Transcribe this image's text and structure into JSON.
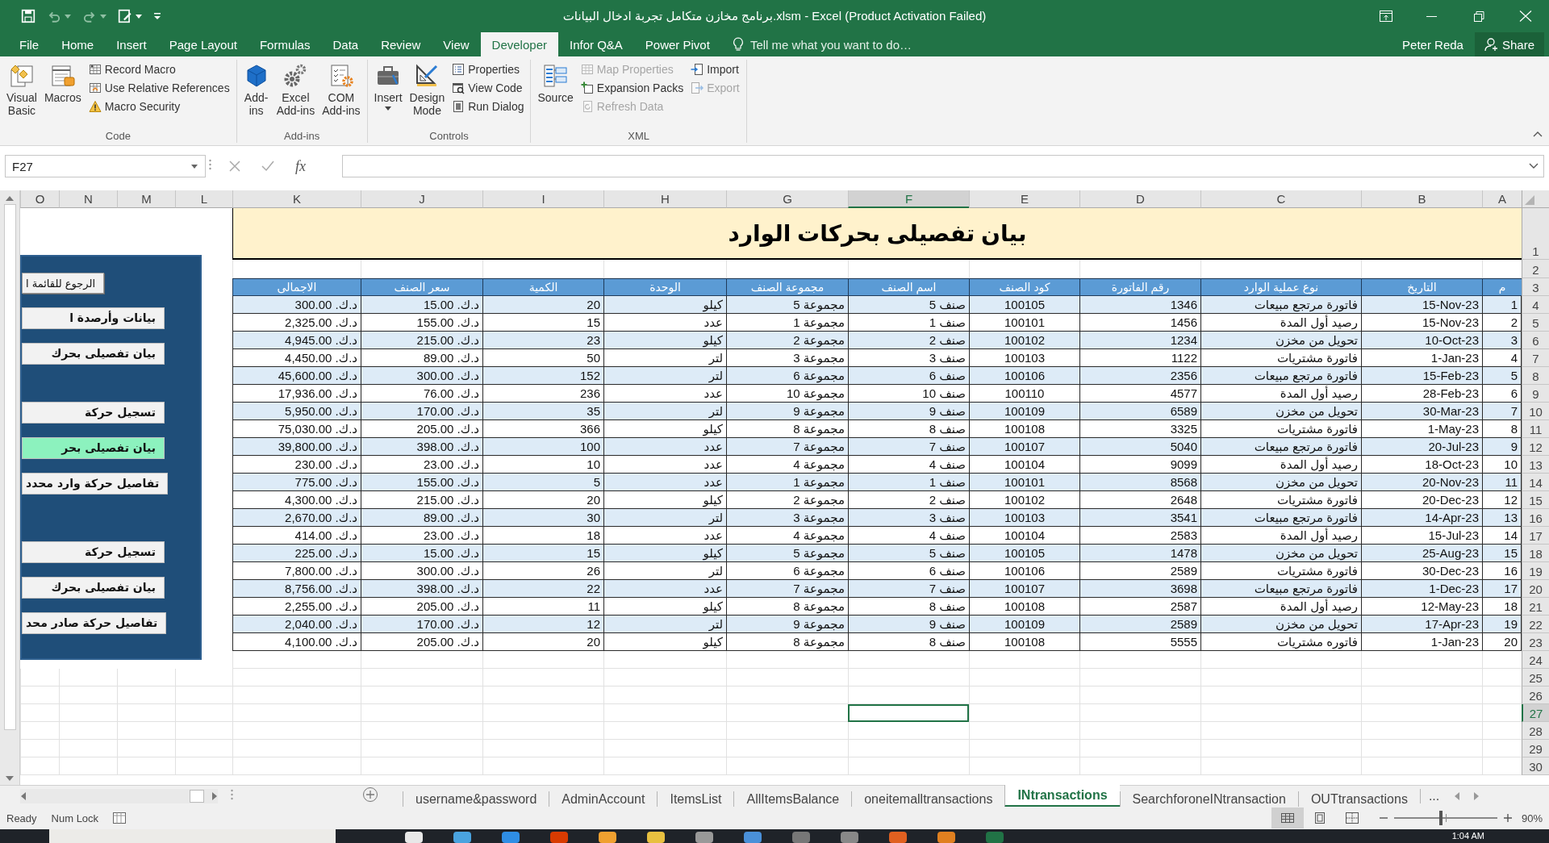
{
  "window": {
    "title": "برنامج مخازن متكامل تجربة ادخال البيانات.xlsm - Excel (Product Activation Failed)"
  },
  "ribbon_tabs": [
    {
      "label": "Power Pivot",
      "selected": false
    },
    {
      "label": "Infor Q&A",
      "selected": false
    },
    {
      "label": "Developer",
      "selected": true
    },
    {
      "label": "View",
      "selected": false
    },
    {
      "label": "Review",
      "selected": false
    },
    {
      "label": "Data",
      "selected": false
    },
    {
      "label": "Formulas",
      "selected": false
    },
    {
      "label": "Page Layout",
      "selected": false
    },
    {
      "label": "Insert",
      "selected": false
    },
    {
      "label": "Home",
      "selected": false
    },
    {
      "label": "File",
      "selected": false
    }
  ],
  "tell_me": {
    "placeholder": "Tell me what you want to do…"
  },
  "user": "Peter Reda",
  "share_button": "Share",
  "ribbon": {
    "groups": [
      {
        "label": "XML",
        "items": [
          {
            "kind": "stack",
            "items": [
              {
                "kind": "small",
                "label": "Import",
                "dropdown": false,
                "disabled": false
              },
              {
                "kind": "small",
                "label": "Export",
                "dropdown": false,
                "disabled": true
              }
            ]
          },
          {
            "kind": "stack",
            "items": [
              {
                "kind": "small",
                "label": "Map Properties",
                "dropdown": false,
                "disabled": true
              },
              {
                "kind": "small",
                "label": "Expansion Packs",
                "dropdown": false,
                "disabled": false
              },
              {
                "kind": "small",
                "label": "Refresh Data",
                "dropdown": false,
                "disabled": true
              }
            ]
          },
          {
            "kind": "large",
            "label": "Source",
            "dropdown": false,
            "disabled": false
          }
        ]
      },
      {
        "label": "Controls",
        "items": [
          {
            "kind": "stack",
            "items": [
              {
                "kind": "small",
                "label": "Properties",
                "dropdown": false,
                "disabled": false
              },
              {
                "kind": "small",
                "label": "View Code",
                "dropdown": false,
                "disabled": false
              },
              {
                "kind": "small",
                "label": "Run Dialog",
                "dropdown": false,
                "disabled": false
              }
            ]
          },
          {
            "kind": "large",
            "label": "Design\nMode",
            "dropdown": false,
            "disabled": false
          },
          {
            "kind": "large",
            "label": "Insert",
            "dropdown": true,
            "disabled": false
          }
        ]
      },
      {
        "label": "Add-ins",
        "items": [
          {
            "kind": "large",
            "label": "COM\nAdd-ins",
            "dropdown": false,
            "disabled": false
          },
          {
            "kind": "large",
            "label": "Excel\nAdd-ins",
            "dropdown": false,
            "disabled": false
          },
          {
            "kind": "large",
            "label": "Add-\nins",
            "dropdown": false,
            "disabled": false
          }
        ]
      },
      {
        "label": "Code",
        "items": [
          {
            "kind": "stack",
            "items": [
              {
                "kind": "small",
                "label": "Record Macro",
                "dropdown": false,
                "disabled": false
              },
              {
                "kind": "small",
                "label": "Use Relative References",
                "dropdown": false,
                "disabled": false
              },
              {
                "kind": "small",
                "label": "Macro Security",
                "dropdown": false,
                "disabled": false
              }
            ]
          },
          {
            "kind": "large",
            "label": "Macros",
            "dropdown": false,
            "disabled": false
          },
          {
            "kind": "large",
            "label": "Visual\nBasic",
            "dropdown": false,
            "disabled": false
          }
        ]
      }
    ]
  },
  "formula_bar": {
    "name_box": "F27",
    "insert_function": "fx"
  },
  "sheet": {
    "column_letters": [
      {
        "label": "A",
        "selected": false
      },
      {
        "label": "B",
        "selected": false
      },
      {
        "label": "C",
        "selected": false
      },
      {
        "label": "D",
        "selected": false
      },
      {
        "label": "E",
        "selected": false
      },
      {
        "label": "F",
        "selected": true
      },
      {
        "label": "G",
        "selected": false
      },
      {
        "label": "H",
        "selected": false
      },
      {
        "label": "I",
        "selected": false
      },
      {
        "label": "J",
        "selected": false
      },
      {
        "label": "K",
        "selected": false
      },
      {
        "label": "L",
        "selected": false
      },
      {
        "label": "M",
        "selected": false
      },
      {
        "label": "N",
        "selected": false
      },
      {
        "label": "O",
        "selected": false
      }
    ],
    "row_numbers": [
      {
        "label": "1",
        "selected": false
      },
      {
        "label": "2",
        "selected": false
      },
      {
        "label": "3",
        "selected": false
      },
      {
        "label": "4",
        "selected": false
      },
      {
        "label": "5",
        "selected": false
      },
      {
        "label": "6",
        "selected": false
      },
      {
        "label": "7",
        "selected": false
      },
      {
        "label": "8",
        "selected": false
      },
      {
        "label": "9",
        "selected": false
      },
      {
        "label": "10",
        "selected": false
      },
      {
        "label": "11",
        "selected": false
      },
      {
        "label": "12",
        "selected": false
      },
      {
        "label": "13",
        "selected": false
      },
      {
        "label": "14",
        "selected": false
      },
      {
        "label": "15",
        "selected": false
      },
      {
        "label": "16",
        "selected": false
      },
      {
        "label": "17",
        "selected": false
      },
      {
        "label": "18",
        "selected": false
      },
      {
        "label": "19",
        "selected": false
      },
      {
        "label": "20",
        "selected": false
      },
      {
        "label": "21",
        "selected": false
      },
      {
        "label": "22",
        "selected": false
      },
      {
        "label": "23",
        "selected": false
      },
      {
        "label": "24",
        "selected": false
      },
      {
        "label": "25",
        "selected": false
      },
      {
        "label": "26",
        "selected": false
      },
      {
        "label": "27",
        "selected": true
      },
      {
        "label": "28",
        "selected": false
      },
      {
        "label": "29",
        "selected": false
      },
      {
        "label": "30",
        "selected": false
      }
    ],
    "title": "بيان تفصيلى بحركات الوارد",
    "table": {
      "columns": [
        "م",
        "التاريخ",
        "نوع عملية الوارد",
        "رقم الفاتورة",
        "كود الصنف",
        "اسم الصنف",
        "مجموعة الصنف",
        "الوحدة",
        "الكمية",
        "سعر الصنف",
        "الاجمالى"
      ],
      "rows": [
        [
          "1",
          "15-Nov-23",
          "فاتورة مرتجع مبيعات",
          "1346",
          "100105",
          "صنف 5",
          "مجموعة 5",
          "كيلو",
          "20",
          "د.ك. 15.00",
          "د.ك. 300.00"
        ],
        [
          "2",
          "15-Nov-23",
          "رصيد أول المدة",
          "1456",
          "100101",
          "صنف 1",
          "مجموعة 1",
          "عدد",
          "15",
          "د.ك. 155.00",
          "د.ك. 2,325.00"
        ],
        [
          "3",
          "10-Oct-23",
          "تحويل من مخزن",
          "1234",
          "100102",
          "صنف 2",
          "مجموعة 2",
          "كيلو",
          "23",
          "د.ك. 215.00",
          "د.ك. 4,945.00"
        ],
        [
          "4",
          "1-Jan-23",
          "فاتورة مشتريات",
          "1122",
          "100103",
          "صنف 3",
          "مجموعة 3",
          "لتر",
          "50",
          "د.ك. 89.00",
          "د.ك. 4,450.00"
        ],
        [
          "5",
          "15-Feb-23",
          "فاتورة مرتجع مبيعات",
          "2356",
          "100106",
          "صنف 6",
          "مجموعة 6",
          "لتر",
          "152",
          "د.ك. 300.00",
          "د.ك. 45,600.00"
        ],
        [
          "6",
          "28-Feb-23",
          "رصيد أول المدة",
          "4577",
          "100110",
          "صنف 10",
          "مجموعة 10",
          "عدد",
          "236",
          "د.ك. 76.00",
          "د.ك. 17,936.00"
        ],
        [
          "7",
          "30-Mar-23",
          "تحويل من مخزن",
          "6589",
          "100109",
          "صنف 9",
          "مجموعة 9",
          "لتر",
          "35",
          "د.ك. 170.00",
          "د.ك. 5,950.00"
        ],
        [
          "8",
          "1-May-23",
          "فاتورة مشتريات",
          "3325",
          "100108",
          "صنف 8",
          "مجموعة 8",
          "كيلو",
          "366",
          "د.ك. 205.00",
          "د.ك. 75,030.00"
        ],
        [
          "9",
          "20-Jul-23",
          "فاتورة مرتجع مبيعات",
          "5040",
          "100107",
          "صنف 7",
          "مجموعة 7",
          "عدد",
          "100",
          "د.ك. 398.00",
          "د.ك. 39,800.00"
        ],
        [
          "10",
          "18-Oct-23",
          "رصيد أول المدة",
          "9099",
          "100104",
          "صنف 4",
          "مجموعة 4",
          "عدد",
          "10",
          "د.ك. 23.00",
          "د.ك. 230.00"
        ],
        [
          "11",
          "20-Nov-23",
          "تحويل من مخزن",
          "8568",
          "100101",
          "صنف 1",
          "مجموعة 1",
          "عدد",
          "5",
          "د.ك. 155.00",
          "د.ك. 775.00"
        ],
        [
          "12",
          "20-Dec-23",
          "فاتورة مشتريات",
          "2648",
          "100102",
          "صنف 2",
          "مجموعة 2",
          "كيلو",
          "20",
          "د.ك. 215.00",
          "د.ك. 4,300.00"
        ],
        [
          "13",
          "14-Apr-23",
          "فاتورة مرتجع مبيعات",
          "3541",
          "100103",
          "صنف 3",
          "مجموعة 3",
          "لتر",
          "30",
          "د.ك. 89.00",
          "د.ك. 2,670.00"
        ],
        [
          "14",
          "15-Jul-23",
          "رصيد أول المدة",
          "2583",
          "100104",
          "صنف 4",
          "مجموعة 4",
          "عدد",
          "18",
          "د.ك. 23.00",
          "د.ك. 414.00"
        ],
        [
          "15",
          "25-Aug-23",
          "تحويل من مخزن",
          "1478",
          "100105",
          "صنف 5",
          "مجموعة 5",
          "كيلو",
          "15",
          "د.ك. 15.00",
          "د.ك. 225.00"
        ],
        [
          "16",
          "30-Dec-23",
          "فاتورة مشتريات",
          "2589",
          "100106",
          "صنف 6",
          "مجموعة 6",
          "لتر",
          "26",
          "د.ك. 300.00",
          "د.ك. 7,800.00"
        ],
        [
          "17",
          "1-Dec-23",
          "فاتورة مرتجع مبيعات",
          "3698",
          "100107",
          "صنف 7",
          "مجموعة 7",
          "عدد",
          "22",
          "د.ك. 398.00",
          "د.ك. 8,756.00"
        ],
        [
          "18",
          "12-May-23",
          "رصيد أول المدة",
          "2587",
          "100108",
          "صنف 8",
          "مجموعة 8",
          "كيلو",
          "11",
          "د.ك. 205.00",
          "د.ك. 2,255.00"
        ],
        [
          "19",
          "17-Apr-23",
          "تحويل من مخزن",
          "2589",
          "100109",
          "صنف 9",
          "مجموعة 9",
          "لتر",
          "12",
          "د.ك. 170.00",
          "د.ك. 2,040.00"
        ],
        [
          "20",
          "1-Jan-23",
          "فاتوره مشتريات",
          "5555",
          "100108",
          "صنف 8",
          "مجموعة 8",
          "كيلو",
          "20",
          "د.ك. 205.00",
          "د.ك. 4,100.00"
        ]
      ]
    },
    "nav_panel": {
      "groups": [
        [
          {
            "kind": "back",
            "label": "الرجوع للقائمة ا",
            "selected": false
          },
          {
            "kind": "nav",
            "label": "بيانات وأرصدة ا",
            "selected": false
          },
          {
            "kind": "nav",
            "label": "بيان تفصيلى بحرك",
            "selected": false
          }
        ],
        [
          {
            "kind": "nav",
            "label": "تسجيل حركة",
            "selected": false
          },
          {
            "kind": "nav",
            "label": "بيان تفصيلى بحر",
            "selected": true
          },
          {
            "kind": "nav",
            "label": "تفاصيل حركة وارد محدد",
            "selected": false
          }
        ],
        [
          {
            "kind": "nav",
            "label": "تسجيل حركة",
            "selected": false
          },
          {
            "kind": "nav",
            "label": "بيان تفصيلى بحرك",
            "selected": false
          },
          {
            "kind": "nav",
            "label": "تفاصيل حركة صادر محد",
            "selected": false
          }
        ]
      ]
    }
  },
  "sheet_tabs": [
    {
      "label": "OUTtransactions",
      "selected": false
    },
    {
      "label": "SearchforoneINtransaction",
      "selected": false
    },
    {
      "label": "INtransactions",
      "selected": true
    },
    {
      "label": "oneitemalltransactions",
      "selected": false
    },
    {
      "label": "AllItemsBalance",
      "selected": false
    },
    {
      "label": "ItemsList",
      "selected": false
    },
    {
      "label": "AdminAccount",
      "selected": false
    },
    {
      "label": "username&password",
      "selected": false
    }
  ],
  "sheet_tabs_more": "...",
  "status_bar": {
    "left": [
      "Num Lock",
      "Ready"
    ],
    "views": [
      {
        "selected": true
      },
      {
        "selected": false
      },
      {
        "selected": false
      }
    ],
    "zoom_slider": {
      "level": 0.45
    },
    "zoom": "90%"
  },
  "taskbar": {
    "time": "1:04 AM"
  }
}
